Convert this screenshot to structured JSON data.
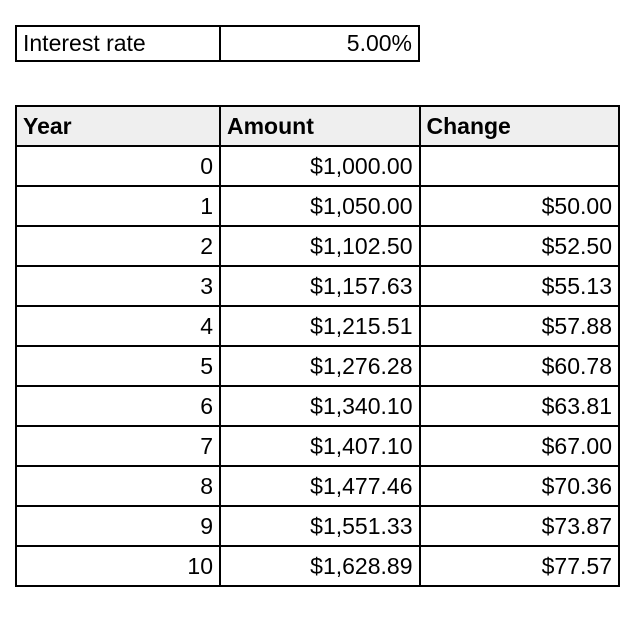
{
  "interest": {
    "label": "Interest rate",
    "value": "5.00%"
  },
  "table": {
    "headers": [
      "Year",
      "Amount",
      "Change"
    ],
    "rows": [
      [
        "0",
        "$1,000.00",
        ""
      ],
      [
        "1",
        "$1,050.00",
        "$50.00"
      ],
      [
        "2",
        "$1,102.50",
        "$52.50"
      ],
      [
        "3",
        "$1,157.63",
        "$55.13"
      ],
      [
        "4",
        "$1,215.51",
        "$57.88"
      ],
      [
        "5",
        "$1,276.28",
        "$60.78"
      ],
      [
        "6",
        "$1,340.10",
        "$63.81"
      ],
      [
        "7",
        "$1,407.10",
        "$67.00"
      ],
      [
        "8",
        "$1,477.46",
        "$70.36"
      ],
      [
        "9",
        "$1,551.33",
        "$73.87"
      ],
      [
        "10",
        "$1,628.89",
        "$77.57"
      ]
    ]
  }
}
